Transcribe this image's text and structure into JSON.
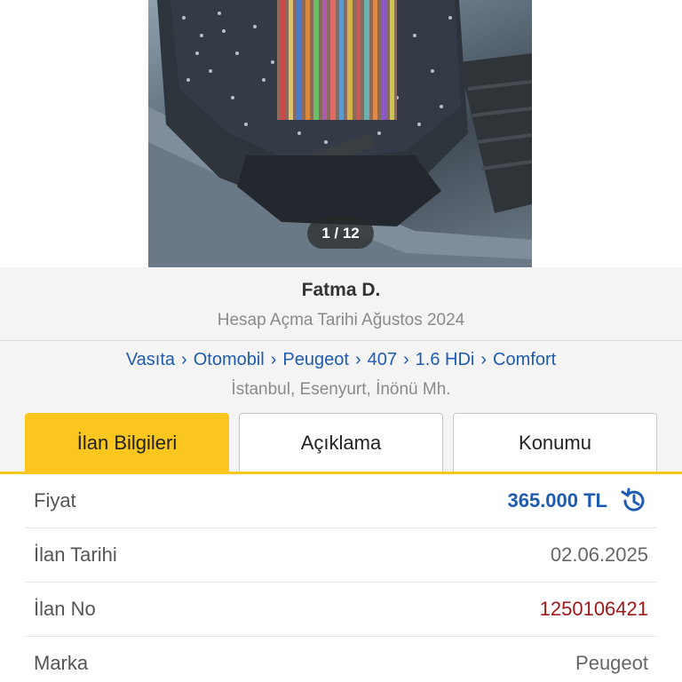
{
  "photo": {
    "counter": "1 / 12"
  },
  "seller": {
    "name": "Fatma D.",
    "since": "Hesap Açma Tarihi Ağustos 2024"
  },
  "breadcrumb": {
    "items": [
      "Vasıta",
      "Otomobil",
      "Peugeot",
      "407",
      "1.6 HDi",
      "Comfort"
    ],
    "separator": "›"
  },
  "location": "İstanbul, Esenyurt, İnönü Mh.",
  "tabs": [
    {
      "label": "İlan Bilgileri",
      "active": true
    },
    {
      "label": "Açıklama",
      "active": false
    },
    {
      "label": "Konumu",
      "active": false
    }
  ],
  "details": [
    {
      "label": "Fiyat",
      "value": "365.000 TL"
    },
    {
      "label": "İlan Tarihi",
      "value": "02.06.2025"
    },
    {
      "label": "İlan No",
      "value": "1250106421"
    },
    {
      "label": "Marka",
      "value": "Peugeot"
    }
  ],
  "icons": {
    "price_history": "history-icon"
  },
  "colors": {
    "accent": "#fbc61d",
    "link": "#1f5bb0",
    "ad_number": "#a01818"
  }
}
